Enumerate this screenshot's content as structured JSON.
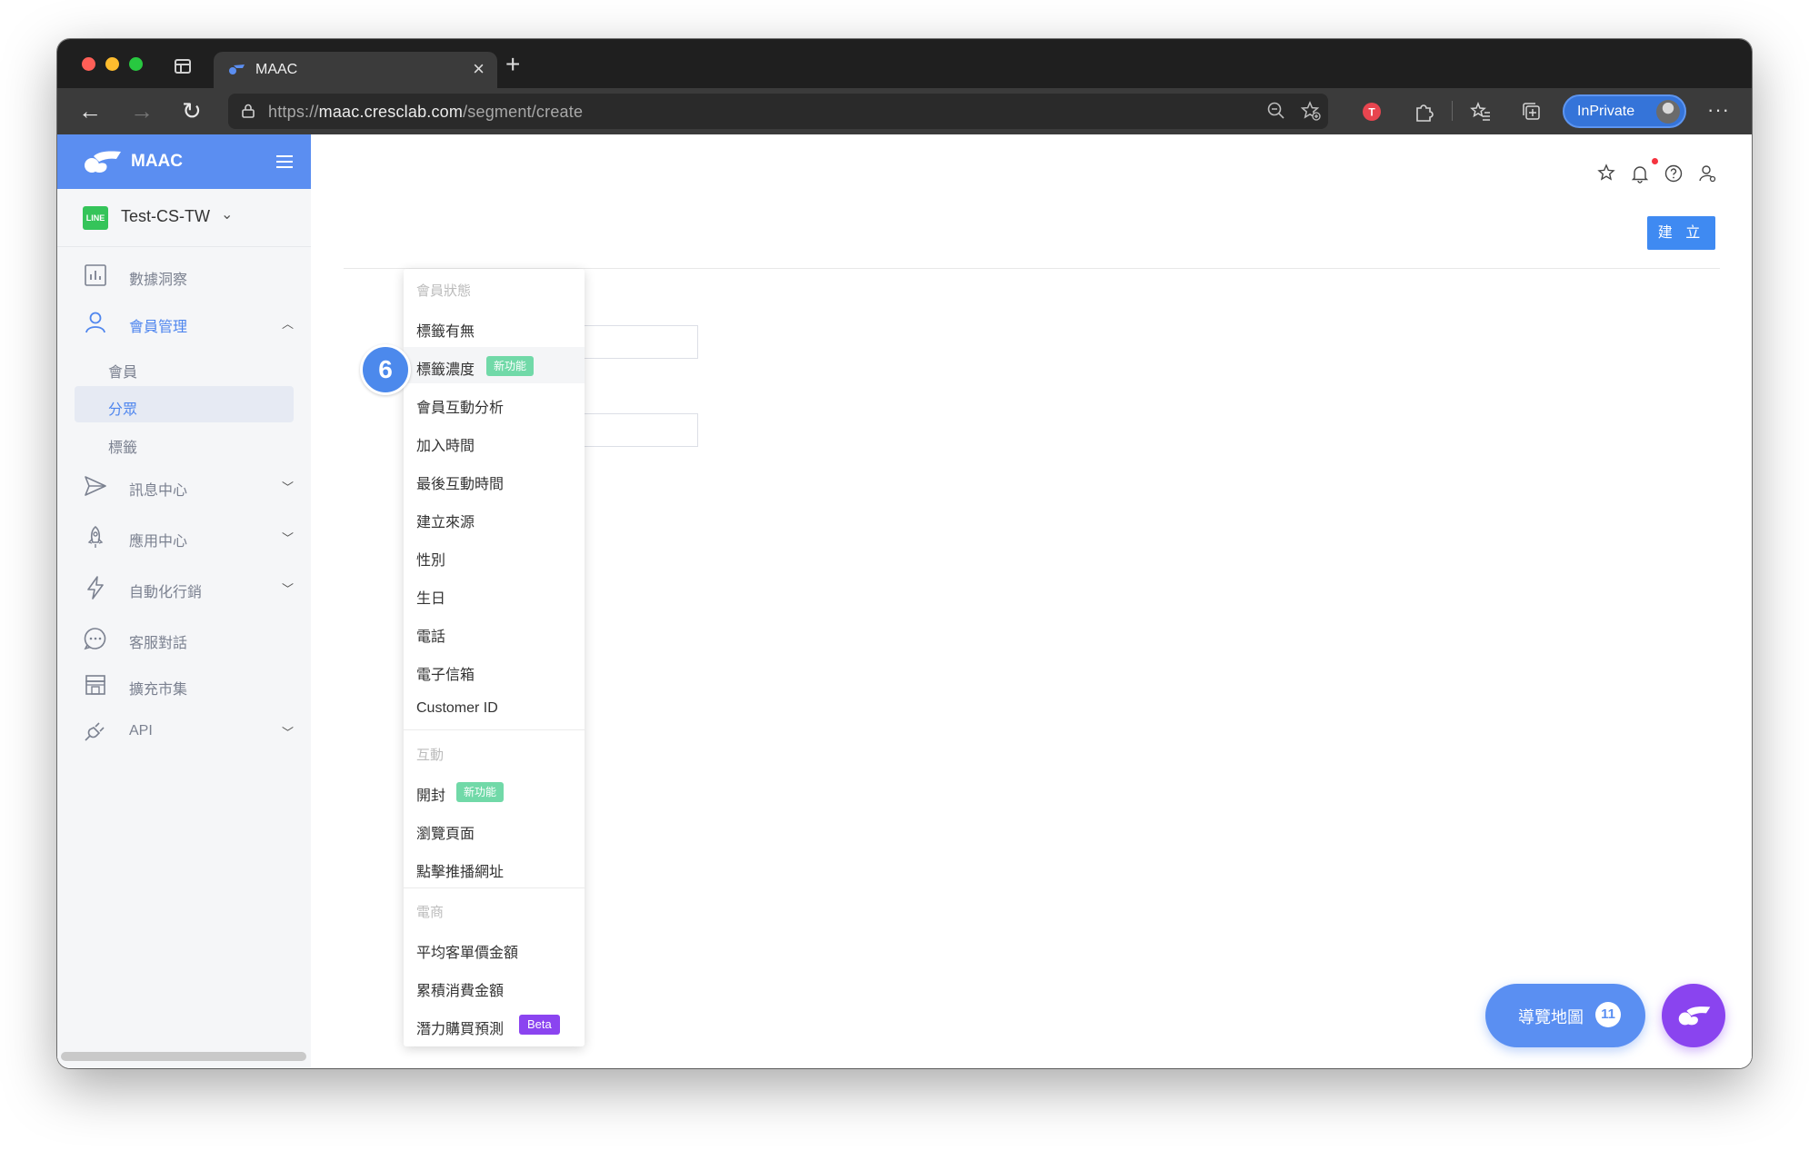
{
  "browser": {
    "tab_title": "MAAC",
    "url_prefix": "https://",
    "url_host": "maac.cresclab.com",
    "url_path": "/segment/create",
    "inprivate_label": "InPrivate"
  },
  "sidebar": {
    "brand": "MAAC",
    "account_badge": "LINE",
    "account_name": "Test-CS-TW",
    "items": [
      {
        "label": "數據洞察"
      },
      {
        "label": "會員管理"
      },
      {
        "label": "訊息中心"
      },
      {
        "label": "應用中心"
      },
      {
        "label": "自動化行銷"
      },
      {
        "label": "客服對話"
      },
      {
        "label": "擴充市集"
      },
      {
        "label": "API"
      }
    ],
    "sub_items": [
      {
        "label": "會員"
      },
      {
        "label": "分眾"
      },
      {
        "label": "標籤"
      }
    ]
  },
  "main": {
    "create_button": "建 立"
  },
  "dropdown": {
    "groups": [
      {
        "label": "會員狀態"
      },
      {
        "label": "互動"
      },
      {
        "label": "電商"
      }
    ],
    "items": [
      {
        "label": "標籤有無"
      },
      {
        "label": "標籤濃度",
        "tag": "新功能"
      },
      {
        "label": "會員互動分析"
      },
      {
        "label": "加入時間"
      },
      {
        "label": "最後互動時間"
      },
      {
        "label": "建立來源"
      },
      {
        "label": "性別"
      },
      {
        "label": "生日"
      },
      {
        "label": "電話"
      },
      {
        "label": "電子信箱"
      },
      {
        "label": "Customer ID"
      },
      {
        "label": "開封",
        "tag": "新功能"
      },
      {
        "label": "瀏覽頁面"
      },
      {
        "label": "點擊推播網址"
      },
      {
        "label": "平均客單價金額"
      },
      {
        "label": "累積消費金額"
      },
      {
        "label": "潛力購買預測",
        "tag": "Beta"
      }
    ]
  },
  "step_badge": "6",
  "roadmap": {
    "label": "導覽地圖",
    "count": "11"
  },
  "colors": {
    "brand": "#5b8ef1",
    "primary_button": "#3f8af2",
    "new_tag": "#71d9a8",
    "beta_tag": "#8b44f0",
    "fab": "#8a44ef"
  }
}
